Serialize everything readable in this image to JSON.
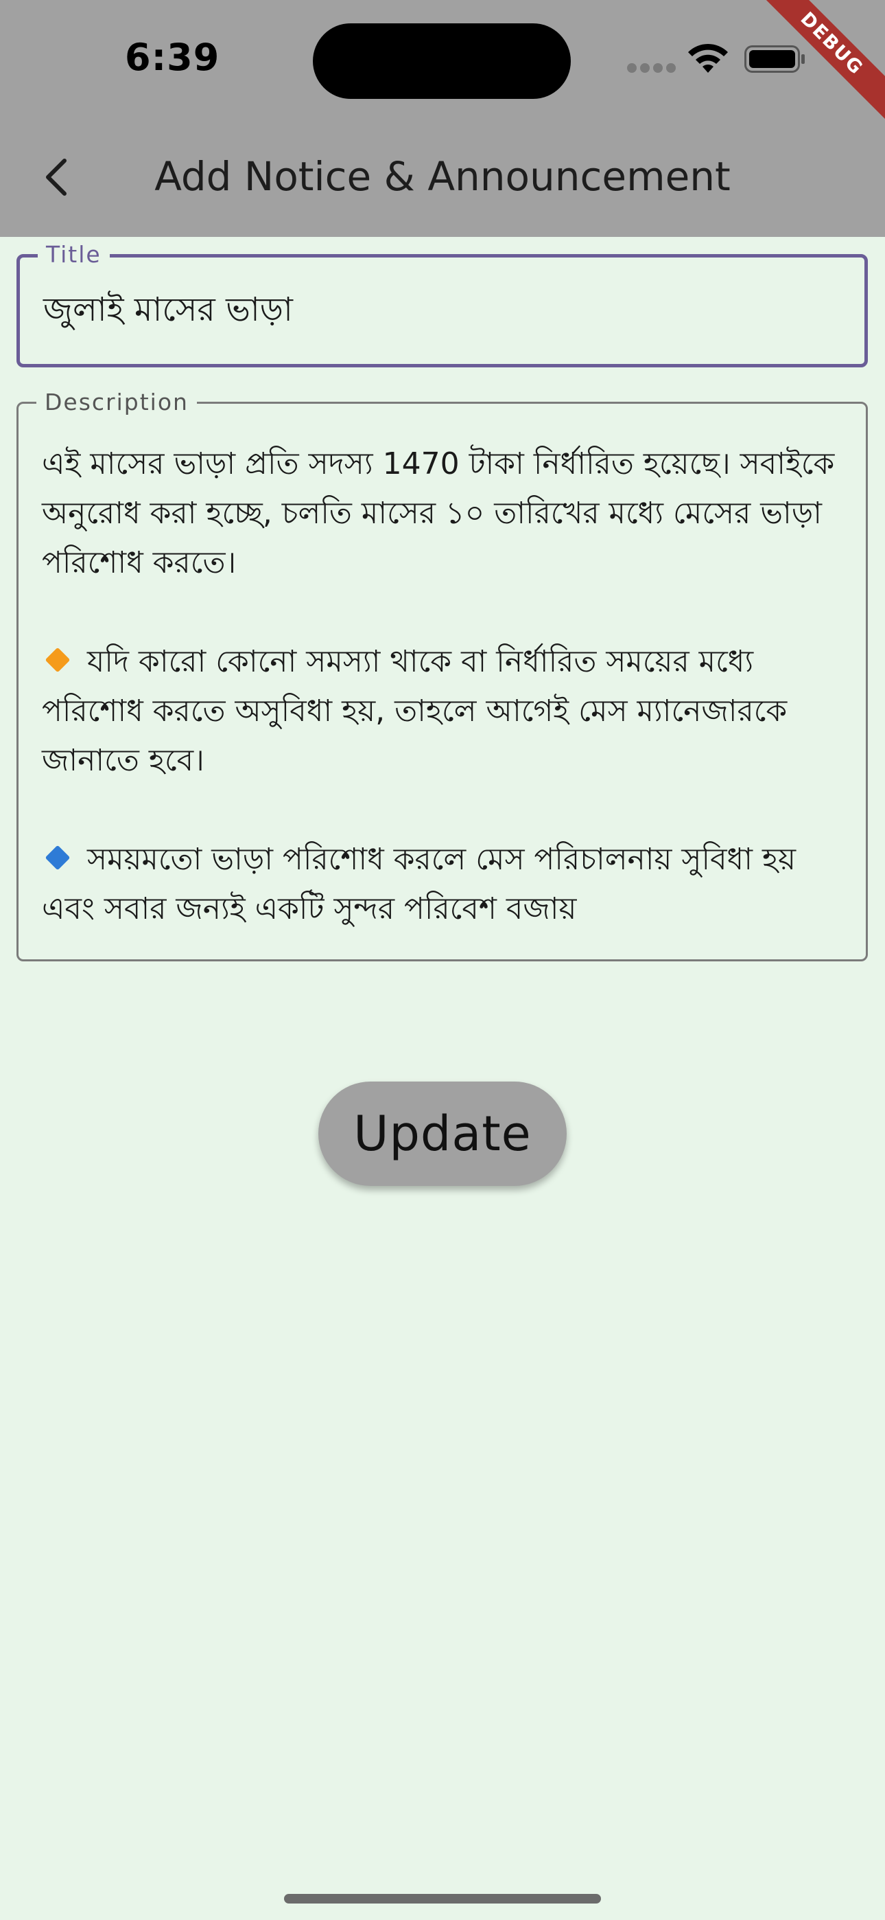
{
  "status_bar": {
    "time": "6:39"
  },
  "debug_banner": {
    "label": "DEBUG"
  },
  "app_bar": {
    "title": "Add Notice & Announcement",
    "back_icon": "chevron-left-icon"
  },
  "form": {
    "title_field": {
      "label": "Title",
      "value": "জুলাই মাসের ভাড়া"
    },
    "description_field": {
      "label": "Description",
      "paragraphs": [
        "এই মাসের ভাড়া প্রতি সদস্য 1470 টাকা নির্ধারিত হয়েছে। সবাইকে অনুরোধ করা হচ্ছে, চলতি মাসের ১০ তারিখের মধ্যে মেসের ভাড়া পরিশোধ করতে।",
        "যদি কারো কোনো সমস্যা থাকে বা নির্ধারিত সময়ের মধ্যে পরিশোধ করতে অসুবিধা হয়, তাহলে আগেই মেস ম্যানেজারকে জানাতে হবে।",
        "সময়মতো ভাড়া পরিশোধ করলে মেস পরিচালনায় সুবিধা হয় এবং সবার জন্যই একটি সুন্দর পরিবেশ বজায়"
      ],
      "bullet_icons": [
        "orange-diamond-icon",
        "blue-diamond-icon"
      ]
    },
    "submit_label": "Update"
  },
  "colors": {
    "background": "#e8f5e9",
    "app_bar": "#a1a1a1",
    "focused_border": "#6a5d97",
    "debug_ribbon": "#a8322d",
    "button": "#a1a1a1"
  }
}
